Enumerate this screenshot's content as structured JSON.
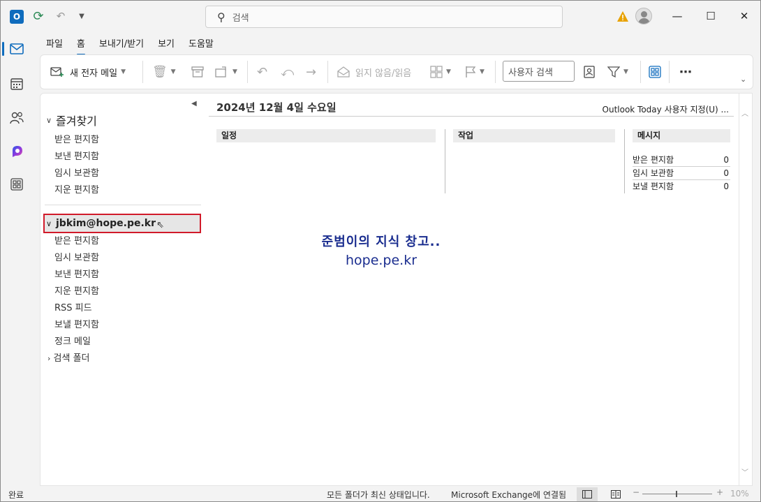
{
  "titlebar": {
    "app_icon_label": "O",
    "search_placeholder": "검색",
    "warning_color": "#e8a200"
  },
  "menu": {
    "tabs": [
      "파일",
      "홈",
      "보내기/받기",
      "보기",
      "도움말"
    ],
    "active_tab": "홈"
  },
  "ribbon": {
    "new_mail": "새 전자 메일",
    "read_unread": "읽지 않음/읽음",
    "people_search_placeholder": "사용자 검색"
  },
  "folders": {
    "favorites_title": "즐겨찾기",
    "favorites": [
      "받은 편지함",
      "보낸 편지함",
      "임시 보관함",
      "지운 편지함"
    ],
    "account": "jbkim@hope.pe.kr",
    "account_folders": [
      "받은 편지함",
      "임시 보관함",
      "보낸 편지함",
      "지운 편지함",
      "RSS 피드",
      "보낼 편지함",
      "정크 메일"
    ],
    "search_folders": "검색 폴더"
  },
  "outlook_today": {
    "date": "2024년 12월 4일 수요일",
    "customize": "Outlook Today 사용자 지정(U) ...",
    "columns": {
      "calendar": "일정",
      "tasks": "작업",
      "messages": "메시지"
    },
    "messages": [
      {
        "label": "받은 편지함",
        "count": "0"
      },
      {
        "label": "임시 보관함",
        "count": "0"
      },
      {
        "label": "보낼 편지함",
        "count": "0"
      }
    ],
    "watermark_line1": "준범이의 지식 창고..",
    "watermark_line2": "hope.pe.kr"
  },
  "status": {
    "left": "완료",
    "sync": "모든 폴더가 최신 상태입니다.",
    "connection": "Microsoft Exchange에 연결됨",
    "zoom": "10%"
  },
  "colors": {
    "accent": "#0f6cbd",
    "highlight_border": "#d11a2a",
    "watermark": "#1a2d8f"
  }
}
